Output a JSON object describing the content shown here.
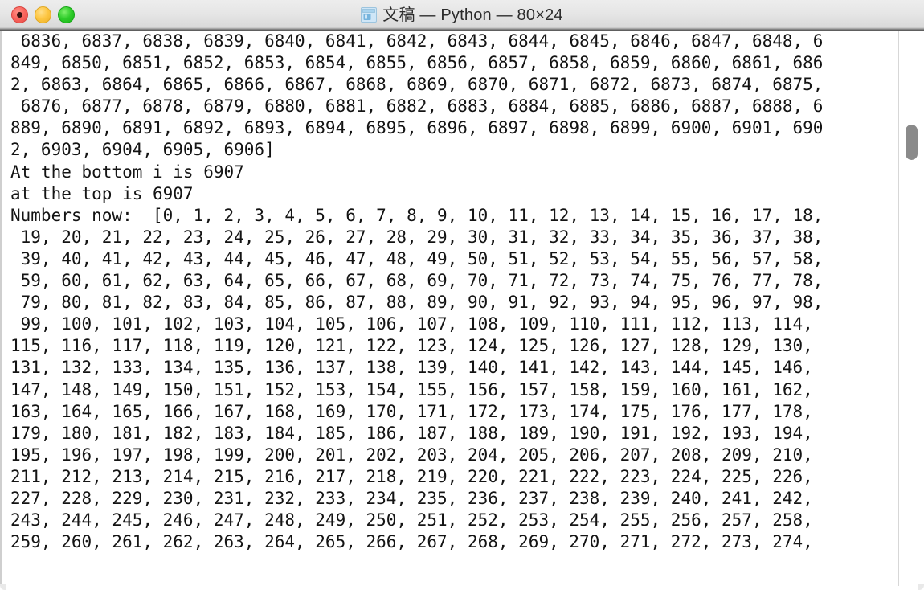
{
  "window": {
    "title": "文稿 — Python — 80×24",
    "icon": "document-icon",
    "controls": {
      "close_label": "close",
      "minimize_label": "minimize",
      "maximize_label": "maximize"
    },
    "columns": 80,
    "rows": 24,
    "accent_colors": {
      "close": "#f9655d",
      "minimize": "#fdc642",
      "maximize": "#2fcc2a",
      "titlebar_top": "#ededed",
      "titlebar_bottom": "#d9d9d9",
      "text": "#141414",
      "background": "#ffffff",
      "scrollbar_thumb": "#8a8a8a"
    }
  },
  "terminal": {
    "lines": [
      " 6836, 6837, 6838, 6839, 6840, 6841, 6842, 6843, 6844, 6845, 6846, 6847, 6848, 6",
      "849, 6850, 6851, 6852, 6853, 6854, 6855, 6856, 6857, 6858, 6859, 6860, 6861, 686",
      "2, 6863, 6864, 6865, 6866, 6867, 6868, 6869, 6870, 6871, 6872, 6873, 6874, 6875,",
      " 6876, 6877, 6878, 6879, 6880, 6881, 6882, 6883, 6884, 6885, 6886, 6887, 6888, 6",
      "889, 6890, 6891, 6892, 6893, 6894, 6895, 6896, 6897, 6898, 6899, 6900, 6901, 690",
      "2, 6903, 6904, 6905, 6906]",
      "At the bottom i is 6907",
      "at the top is 6907",
      "Numbers now:  [0, 1, 2, 3, 4, 5, 6, 7, 8, 9, 10, 11, 12, 13, 14, 15, 16, 17, 18,",
      " 19, 20, 21, 22, 23, 24, 25, 26, 27, 28, 29, 30, 31, 32, 33, 34, 35, 36, 37, 38,",
      " 39, 40, 41, 42, 43, 44, 45, 46, 47, 48, 49, 50, 51, 52, 53, 54, 55, 56, 57, 58,",
      " 59, 60, 61, 62, 63, 64, 65, 66, 67, 68, 69, 70, 71, 72, 73, 74, 75, 76, 77, 78,",
      " 79, 80, 81, 82, 83, 84, 85, 86, 87, 88, 89, 90, 91, 92, 93, 94, 95, 96, 97, 98,",
      " 99, 100, 101, 102, 103, 104, 105, 106, 107, 108, 109, 110, 111, 112, 113, 114,",
      "115, 116, 117, 118, 119, 120, 121, 122, 123, 124, 125, 126, 127, 128, 129, 130,",
      "131, 132, 133, 134, 135, 136, 137, 138, 139, 140, 141, 142, 143, 144, 145, 146,",
      "147, 148, 149, 150, 151, 152, 153, 154, 155, 156, 157, 158, 159, 160, 161, 162,",
      "163, 164, 165, 166, 167, 168, 169, 170, 171, 172, 173, 174, 175, 176, 177, 178,",
      "179, 180, 181, 182, 183, 184, 185, 186, 187, 188, 189, 190, 191, 192, 193, 194,",
      "195, 196, 197, 198, 199, 200, 201, 202, 203, 204, 205, 206, 207, 208, 209, 210,",
      "211, 212, 213, 214, 215, 216, 217, 218, 219, 220, 221, 222, 223, 224, 225, 226,",
      "227, 228, 229, 230, 231, 232, 233, 234, 235, 236, 237, 238, 239, 240, 241, 242,",
      "243, 244, 245, 246, 247, 248, 249, 250, 251, 252, 253, 254, 255, 256, 257, 258,",
      "259, 260, 261, 262, 263, 264, 265, 266, 267, 268, 269, 270, 271, 272, 273, 274,"
    ]
  }
}
